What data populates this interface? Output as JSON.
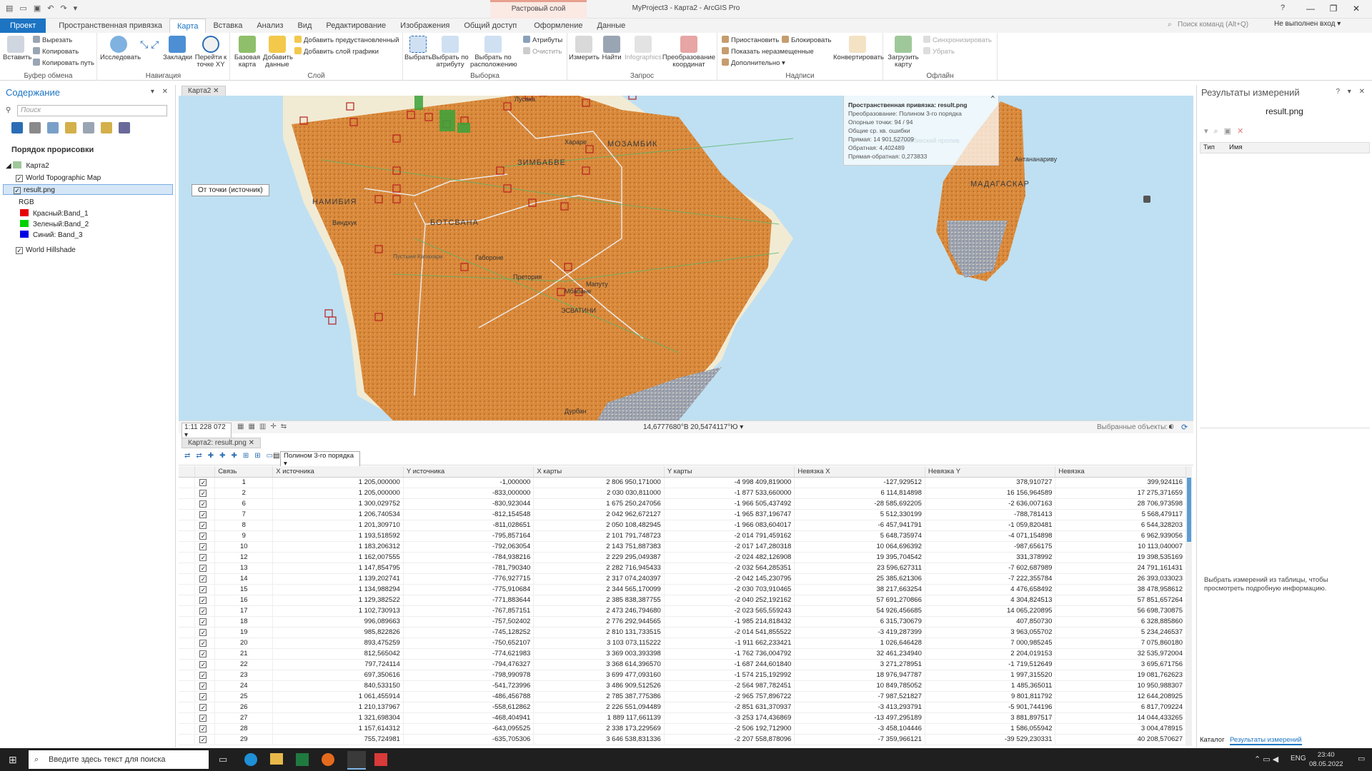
{
  "window": {
    "title": "MyProject3 - Карта2 - ArcGIS Pro",
    "context_tab": "Растровый слой",
    "help": "?",
    "minimize": "—",
    "restore": "❐",
    "close": "✕"
  },
  "tabs": [
    "Проект",
    "Пространственная привязка",
    "Карта",
    "Вставка",
    "Анализ",
    "Вид",
    "Редактирование",
    "Изображения",
    "Общий доступ",
    "Оформление",
    "Данные"
  ],
  "command_search": "Поиск команд (Alt+Q)",
  "signin": "Не выполнен вход ▾",
  "ribbon": {
    "clipboard": {
      "label": "Буфер обмена",
      "paste": "Вставить",
      "cut": "Вырезать",
      "copy": "Копировать",
      "copy_path": "Копировать путь"
    },
    "navigation": {
      "label": "Навигация",
      "explore": "Исследовать",
      "bookmarks": "Закладки",
      "goto_xy": "Перейти к точке XY"
    },
    "layer": {
      "label": "Слой",
      "basemap": "Базовая карта",
      "add_data": "Добавить данные",
      "add_preset": "Добавить предустановленный",
      "add_graphics": "Добавить слой графики"
    },
    "selection": {
      "label": "Выборка",
      "select": "Выбрать",
      "by_attr": "Выбрать по атрибуту",
      "by_loc": "Выбрать по расположению",
      "attributes": "Атрибуты",
      "clear": "Очистить"
    },
    "inquiry": {
      "label": "Запрос",
      "measure": "Измерить",
      "find": "Найти",
      "infographics": "Infographics",
      "convert_coord": "Преобразование координат"
    },
    "labeling": {
      "label": "Надписи",
      "pause": "Приостановить",
      "lock": "Блокировать",
      "show_unplaced": "Показать неразмещенные",
      "more": "Дополнительно ▾",
      "convert": "Конвертировать"
    },
    "offline": {
      "label": "Офлайн",
      "download": "Загрузить карту",
      "sync": "Синхронизировать",
      "remove": "Убрать"
    }
  },
  "toc": {
    "title": "Содержание",
    "search_placeholder": "Поиск",
    "order_label": "Порядок прорисовки",
    "map_name": "Карта2",
    "layers": [
      "World Topographic Map",
      "result.png"
    ],
    "rgb_label": "RGB",
    "bands": [
      {
        "label": "Красный:Band_1",
        "color": "#e60000"
      },
      {
        "label": "Зеленый:Band_2",
        "color": "#00d000"
      },
      {
        "label": "Синий: Band_3",
        "color": "#0000e6"
      }
    ],
    "hillshade": "World Hillshade"
  },
  "map": {
    "tab": "Карта2",
    "tooltip": "От точки (источник)",
    "labels": [
      {
        "t": "НАМИБИЯ",
        "k": "country"
      },
      {
        "t": "БОТСВАНА",
        "k": "country"
      },
      {
        "t": "ЗИМБАБВЕ",
        "k": "country"
      },
      {
        "t": "МОЗАМБИК",
        "k": "country"
      },
      {
        "t": "МАДАГАСКАР",
        "k": "country"
      },
      {
        "t": "Мозамбикский пролив",
        "k": "water"
      },
      {
        "t": "Хараре",
        "k": "city"
      },
      {
        "t": "Претория",
        "k": "city"
      },
      {
        "t": "Мапуту",
        "k": "city"
      },
      {
        "t": "Мбабане",
        "k": "city"
      },
      {
        "t": "Дурбан",
        "k": "city"
      },
      {
        "t": "Габороне",
        "k": "city"
      },
      {
        "t": "Пустыня Калахари",
        "k": "region"
      },
      {
        "t": "Виндхук",
        "k": "city"
      },
      {
        "t": "Лусака",
        "k": "city"
      },
      {
        "t": "ЭСВАТИНИ",
        "k": "city"
      },
      {
        "t": "Антананариву",
        "k": "city"
      }
    ],
    "info": {
      "title": "Пространственная привязка: result.png",
      "lines": [
        "Преобразование: Полином 3-го порядка",
        "Опорные точки: 94 / 94",
        "Общие ср. кв. ошибки",
        "Прямая: 14 901,527009",
        "Обратная: 4,402489",
        "Прямая-обратная: 0,273833"
      ]
    },
    "scale": "1:11 228 072",
    "coords": "14,6777680°В 20,5474117°Ю ▾",
    "selected": "Выбранные объекты: 0"
  },
  "table": {
    "tab": "Карта2: result.png",
    "transform": "Полином 3-го порядка",
    "columns": [
      "Связь",
      "X источника",
      "Y источника",
      "X карты",
      "Y карты",
      "Невязка X",
      "Невязка Y",
      "Невязка"
    ],
    "rows": [
      [
        "1",
        "1 205,000000",
        "-1,000000",
        "2 806 950,171000",
        "-4 998 409,819000",
        "-127,929512",
        "378,910727",
        "399,924116"
      ],
      [
        "2",
        "1 205,000000",
        "-833,000000",
        "2 030 030,811000",
        "-1 877 533,660000",
        "6 114,814898",
        "16 156,964589",
        "17 275,371659"
      ],
      [
        "6",
        "1 300,029752",
        "-830,923044",
        "1 675 250,247056",
        "-1 966 505,437492",
        "-28 585,692205",
        "-2 636,007163",
        "28 706,973598"
      ],
      [
        "7",
        "1 206,740534",
        "-812,154548",
        "2 042 962,672127",
        "-1 965 837,196747",
        "5 512,330199",
        "-788,781413",
        "5 568,479117"
      ],
      [
        "8",
        "1 201,309710",
        "-811,028651",
        "2 050 108,482945",
        "-1 966 083,604017",
        "-6 457,941791",
        "-1 059,820481",
        "6 544,328203"
      ],
      [
        "9",
        "1 193,518592",
        "-795,857164",
        "2 101 791,748723",
        "-2 014 791,459162",
        "5 648,735974",
        "-4 071,154898",
        "6 962,939056"
      ],
      [
        "10",
        "1 183,206312",
        "-792,063054",
        "2 143 751,887383",
        "-2 017 147,280318",
        "10 064,696392",
        "-987,656175",
        "10 113,040007"
      ],
      [
        "12",
        "1 162,007555",
        "-784,938216",
        "2 229 295,049387",
        "-2 024 482,126908",
        "19 395,704542",
        "331,378992",
        "19 398,535169"
      ],
      [
        "13",
        "1 147,854795",
        "-781,790340",
        "2 282 716,945433",
        "-2 032 564,285351",
        "23 596,627311",
        "-7 602,687989",
        "24 791,161431"
      ],
      [
        "14",
        "1 139,202741",
        "-776,927715",
        "2 317 074,240397",
        "-2 042 145,230795",
        "25 385,621306",
        "-7 222,355784",
        "26 393,033023"
      ],
      [
        "15",
        "1 134,988294",
        "-775,910684",
        "2 344 565,170099",
        "-2 030 703,910465",
        "38 217,663254",
        "4 476,658492",
        "38 478,958612"
      ],
      [
        "16",
        "1 129,382522",
        "-771,883644",
        "2 385 838,387755",
        "-2 040 252,192162",
        "57 691,270866",
        "4 304,824513",
        "57 851,657264"
      ],
      [
        "17",
        "1 102,730913",
        "-767,857151",
        "2 473 246,794680",
        "-2 023 565,559243",
        "54 926,456685",
        "14 065,220895",
        "56 698,730875"
      ],
      [
        "18",
        "996,089663",
        "-757,502402",
        "2 776 292,944565",
        "-1 985 214,818432",
        "6 315,730679",
        "407,850730",
        "6 328,885860"
      ],
      [
        "19",
        "985,822826",
        "-745,128252",
        "2 810 131,733515",
        "-2 014 541,855522",
        "-3 419,287399",
        "3 963,055702",
        "5 234,246537"
      ],
      [
        "20",
        "893,475259",
        "-750,652107",
        "3 103 073,115222",
        "-1 911 662,233421",
        "1 026,646428",
        "7 000,985245",
        "7 075,860180"
      ],
      [
        "21",
        "812,565042",
        "-774,621983",
        "3 369 003,393398",
        "-1 762 736,004792",
        "32 461,234940",
        "2 204,019153",
        "32 535,972004"
      ],
      [
        "22",
        "797,724114",
        "-794,476327",
        "3 368 614,396570",
        "-1 687 244,601840",
        "3 271,278951",
        "-1 719,512649",
        "3 695,671756"
      ],
      [
        "23",
        "697,350616",
        "-798,990978",
        "3 699 477,093160",
        "-1 574 215,192992",
        "18 976,947787",
        "1 997,315520",
        "19 081,762623"
      ],
      [
        "24",
        "840,533150",
        "-541,723996",
        "3 486 909,512526",
        "-2 564 987,782451",
        "10 849,785052",
        "1 485,365011",
        "10 950,988307"
      ],
      [
        "25",
        "1 061,455914",
        "-486,456788",
        "2 785 387,775386",
        "-2 965 757,896722",
        "-7 987,521827",
        "9 801,811792",
        "12 644,208925"
      ],
      [
        "26",
        "1 210,137967",
        "-558,612862",
        "2 226 551,094489",
        "-2 851 631,370937",
        "-3 413,293791",
        "-5 901,744196",
        "6 817,709224"
      ],
      [
        "27",
        "1 321,698304",
        "-468,404941",
        "1 889 117,661139",
        "-3 253 174,436869",
        "-13 497,295189",
        "3 881,897517",
        "14 044,433265"
      ],
      [
        "28",
        "1 157,614312",
        "-643,095525",
        "2 338 173,229569",
        "-2 506 192,712900",
        "-3 458,104446",
        "1 586,055942",
        "3 004,478915"
      ],
      [
        "29",
        "755,724981",
        "-635,705306",
        "3 646 538,831336",
        "-2 207 558,878096",
        "-7 359,966121",
        "-39 529,230331",
        "40 208,570627"
      ]
    ]
  },
  "results": {
    "title": "Результаты измерений",
    "file": "result.png",
    "col_type": "Тип",
    "col_name": "Имя",
    "hint": "Выбрать измерений из таблицы, чтобы просмотреть подробную информацию.",
    "tab_catalog": "Каталог",
    "tab_results": "Результаты измерений"
  },
  "taskbar": {
    "search": "Введите здесь текст для поиска",
    "lang": "ENG",
    "time": "23:40",
    "date": "08.05.2022"
  }
}
